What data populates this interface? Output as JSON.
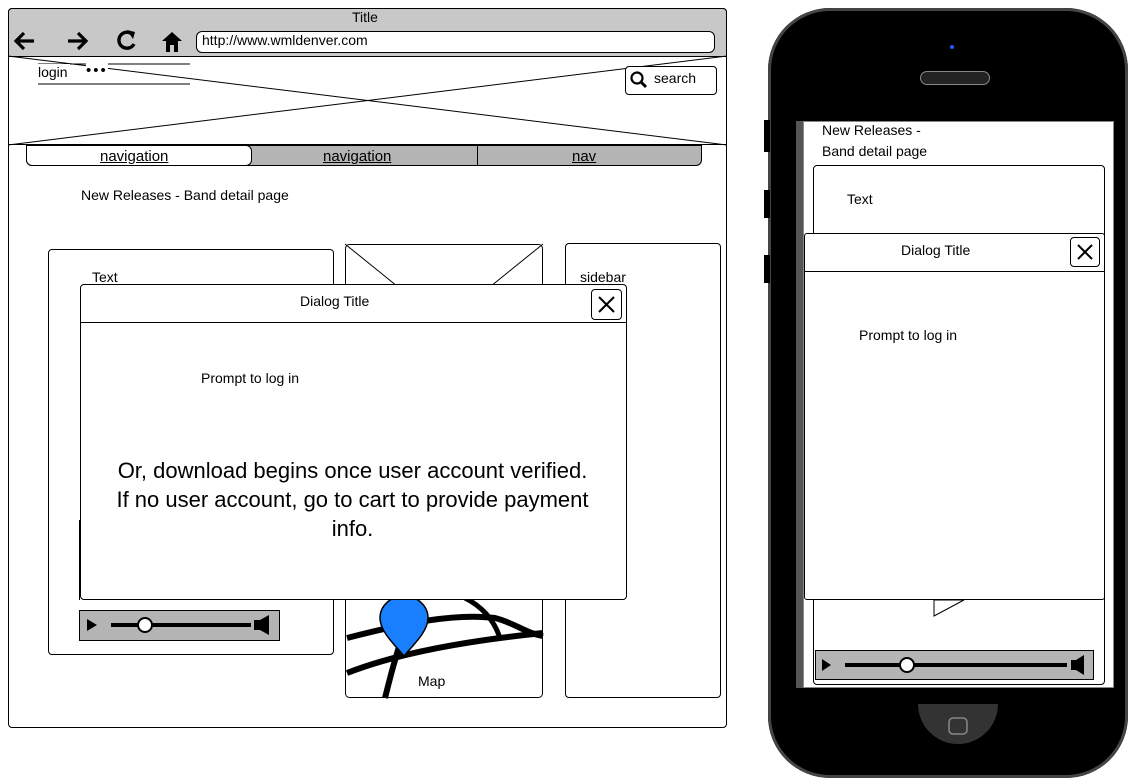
{
  "browser": {
    "title": "Title",
    "url": "http://www.wmldenver.com",
    "login_label": "login",
    "login_more": "•••",
    "search_label": "search",
    "nav": [
      "navigation",
      "navigation",
      "nav"
    ],
    "page_heading": "New Releases - Band detail page",
    "text_panel_label": "Text",
    "sidebar_label": "sidebar",
    "map_label": "Map",
    "dialog": {
      "title": "Dialog Title",
      "prompt": "Prompt to log in",
      "body": "Or, download begins once user account verified. If no user account, go to cart to provide payment info.",
      "close_glyph": "✕"
    }
  },
  "phone": {
    "heading_line1": "New Releases -",
    "heading_line2": "Band detail page",
    "text_label": "Text",
    "dialog": {
      "title": "Dialog Title",
      "prompt": "Prompt to log in",
      "close_glyph": "✕"
    }
  },
  "colors": {
    "frame_gray": "#c8c8c8",
    "nav_gray": "#b4b4b4",
    "map_pin": "#1a7fff",
    "phone_body": "#000000",
    "phone_dot": "#1e5aff"
  }
}
